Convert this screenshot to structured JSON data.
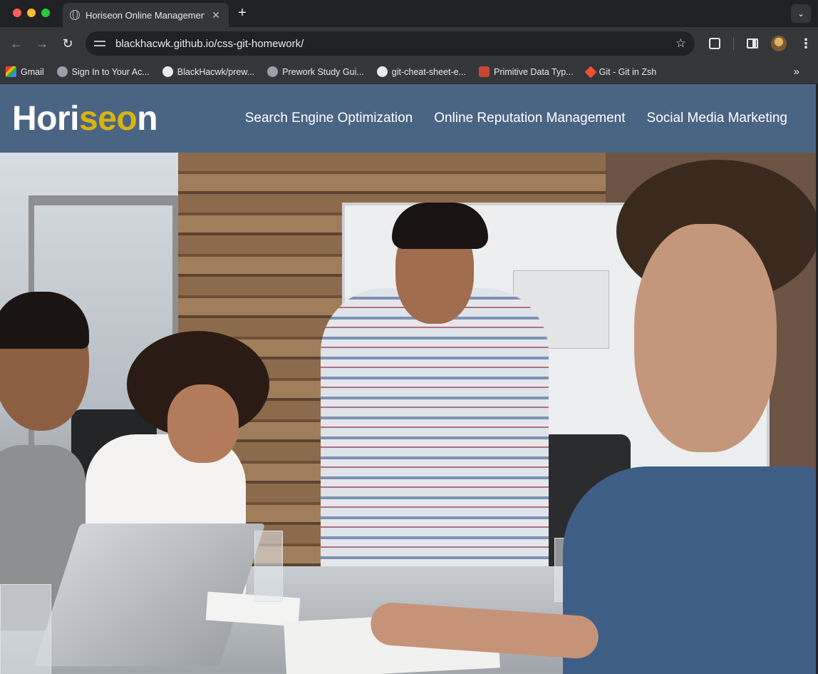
{
  "browser": {
    "tab_title": "Horiseon Online Management",
    "tab_close": "✕",
    "new_tab": "+",
    "tab_menu": "⌄",
    "url": "blackhacwk.github.io/css-git-homework/",
    "back": "←",
    "forward": "→",
    "reload": "↻",
    "star": "☆",
    "kebab": "⋮",
    "bookmarks_more": "»",
    "bookmarks": [
      {
        "label": "Gmail",
        "icon": "gmail-icon"
      },
      {
        "label": "Sign In to Your Ac...",
        "icon": "globe-icon"
      },
      {
        "label": "BlackHacwk/prew...",
        "icon": "github-icon"
      },
      {
        "label": "Prework Study Gui...",
        "icon": "globe-icon"
      },
      {
        "label": "git-cheat-sheet-e...",
        "icon": "github-icon"
      },
      {
        "label": "Primitive Data Typ...",
        "icon": "oracle-icon"
      },
      {
        "label": "Git - Git in Zsh",
        "icon": "git-icon"
      }
    ]
  },
  "site": {
    "logo_start": "Hori",
    "logo_mid": "seo",
    "logo_end": "n",
    "nav": [
      "Search Engine Optimization",
      "Online Reputation Management",
      "Social Media Marketing"
    ],
    "header_color": "#4a6584"
  }
}
